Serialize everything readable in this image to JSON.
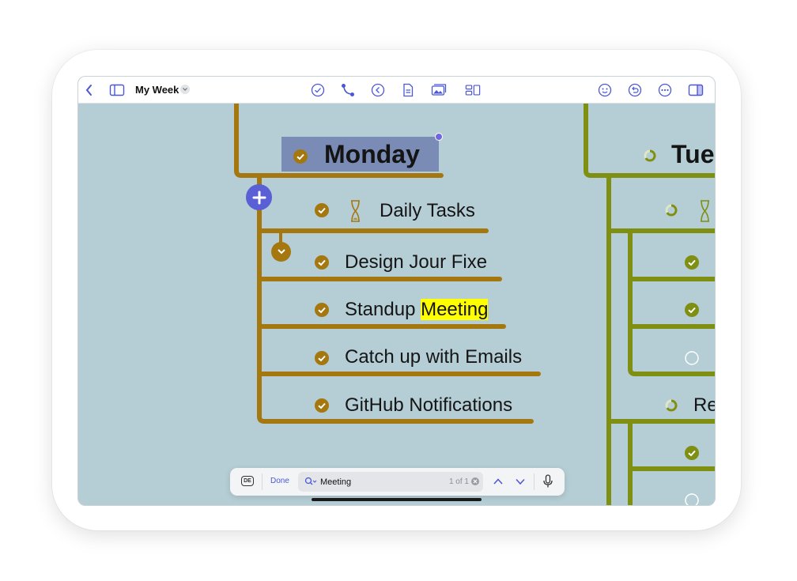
{
  "colors": {
    "canvas_bg": "#b5cdd4",
    "monday_branch": "#a5770f",
    "tuesday_branch": "#7f8f12",
    "monday_selection": "#7a8cb6",
    "add_button": "#5b5fd6",
    "search_highlight": "#ffff00",
    "accent": "#4c57d6"
  },
  "toolbar": {
    "title": "My Week",
    "left_icons": [
      "back-chevron-icon",
      "sidebar-icon"
    ],
    "center_icons": [
      "check-circle-icon",
      "connector-icon",
      "collapse-left-icon",
      "document-icon",
      "image-icon",
      "layout-icon"
    ],
    "right_icons": [
      "smiley-icon",
      "undo-icon",
      "more-icon",
      "inspector-icon"
    ]
  },
  "mindmap": {
    "monday": {
      "title": "Monday",
      "tasks": [
        {
          "label": "Daily Tasks",
          "icon": "hourglass-icon"
        },
        {
          "label": "Design Jour Fixe"
        },
        {
          "label_before": "Standup ",
          "label_match": "Meeting"
        },
        {
          "label": "Catch up with Emails"
        },
        {
          "label": "GitHub Notifications"
        }
      ]
    },
    "tuesday": {
      "title_partial": "Tue",
      "row_partial": "Re"
    }
  },
  "findbar": {
    "keyboard_label": "DE",
    "done_label": "Done",
    "query": "Meeting",
    "count": "1 of 1"
  }
}
